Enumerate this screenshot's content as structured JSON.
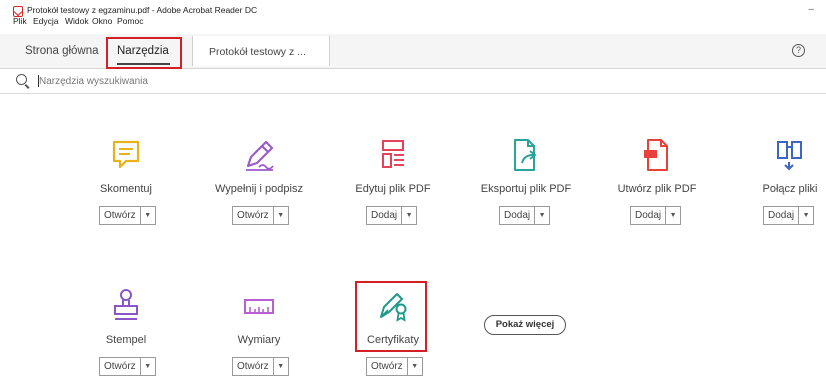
{
  "window": {
    "title": "Protokół testowy z egzaminu.pdf - Adobe Acrobat Reader DC",
    "minimize": "–"
  },
  "menu": [
    "Plik",
    "Edycja",
    "Widok",
    "Okno",
    "Pomoc"
  ],
  "tabs": {
    "home": "Strona główna",
    "tools": "Narzędzia",
    "document": "Protokół testowy z ..."
  },
  "help": "?",
  "search": {
    "placeholder": "Narzędzia wyszukiwania",
    "value": ""
  },
  "tools": [
    {
      "label": "Skomentuj",
      "action": "Otwórz",
      "icon": "comment-icon",
      "color": "#e8b21c"
    },
    {
      "label": "Wypełnij i podpisz",
      "action": "Otwórz",
      "icon": "fill-sign-icon",
      "color": "#9b59d0"
    },
    {
      "label": "Edytuj plik PDF",
      "action": "Dodaj",
      "icon": "edit-pdf-icon",
      "color": "#e2445c"
    },
    {
      "label": "Eksportuj plik PDF",
      "action": "Dodaj",
      "icon": "export-pdf-icon",
      "color": "#2aa39a"
    },
    {
      "label": "Utwórz plik PDF",
      "action": "Dodaj",
      "icon": "create-pdf-icon",
      "color": "#e8403a"
    },
    {
      "label": "Połącz pliki",
      "action": "Dodaj",
      "icon": "combine-files-icon",
      "color": "#3c66c4"
    },
    {
      "label": "Stempel",
      "action": "Otwórz",
      "icon": "stamp-icon",
      "color": "#8a55c8"
    },
    {
      "label": "Wymiary",
      "action": "Otwórz",
      "icon": "measure-icon",
      "color": "#b95ed3"
    },
    {
      "label": "Certyfikaty",
      "action": "Otwórz",
      "icon": "certificate-icon",
      "color": "#1f9a8a"
    }
  ],
  "more_button": "Pokaż więcej",
  "highlight_color": "#d41f26"
}
